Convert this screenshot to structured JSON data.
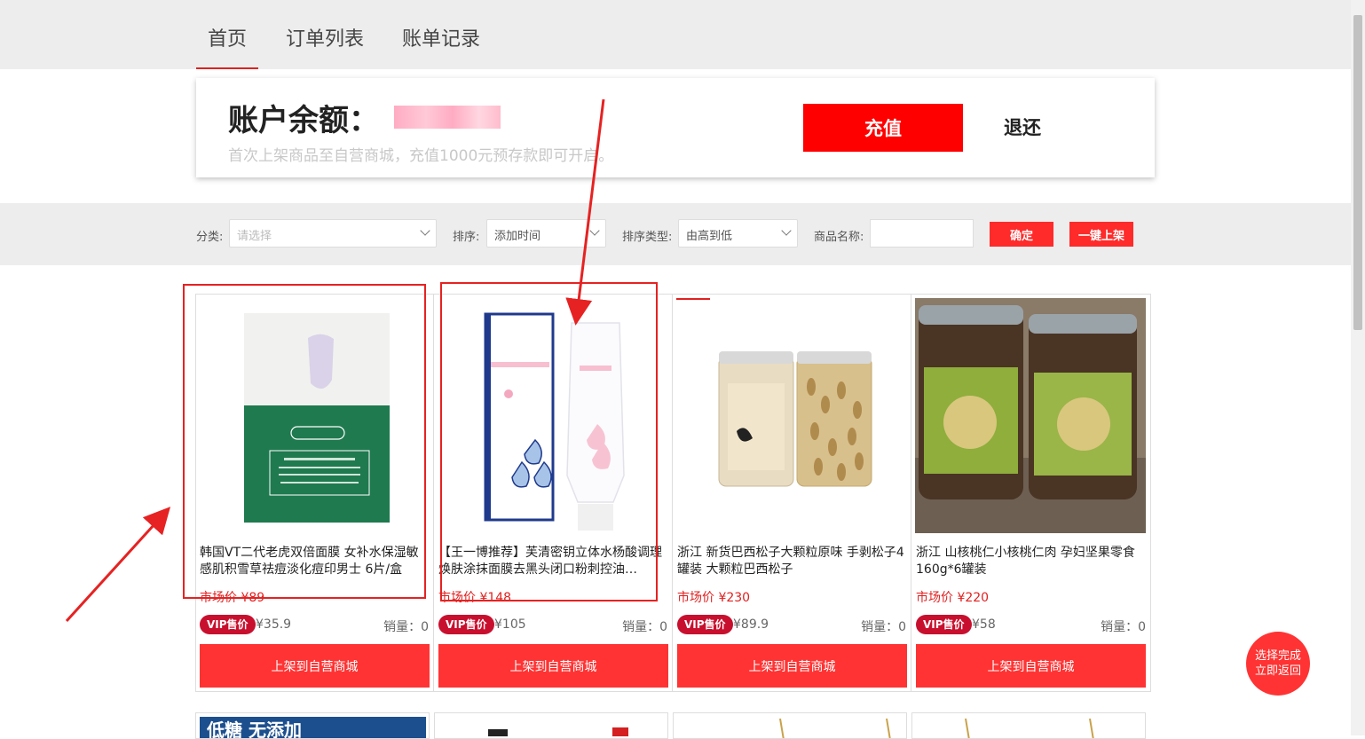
{
  "nav": {
    "tabs": [
      {
        "label": "首页"
      },
      {
        "label": "订单列表"
      },
      {
        "label": "账单记录"
      }
    ],
    "active_tab": "首页"
  },
  "balance": {
    "title": "账户余额：",
    "value_hidden": true,
    "subtitle": "首次上架商品至自营商城，充值1000元预存款即可开启。",
    "recharge_label": "充值",
    "refund_label": "退还"
  },
  "filters": {
    "category_label": "分类:",
    "category_placeholder": "请选择",
    "sort_label": "排序:",
    "sort_value": "添加时间",
    "sort_type_label": "排序类型:",
    "sort_type_value": "由高到低",
    "name_label": "商品名称:",
    "confirm_label": "确定",
    "bulk_list_label": "一键上架"
  },
  "products": [
    {
      "name": "韩国VT二代老虎双倍面膜 女补水保湿敏感肌积雪草祛痘淡化痘印男士 6片/盒",
      "market_price": "市场价 ¥89",
      "vip_badge": "VIP售价",
      "vip_price": "¥35.9",
      "sales": "销量：0",
      "action": "上架到自营商城",
      "image": "vt-cica-mask"
    },
    {
      "name": "【王一博推荐】芙清密钥立体水杨酸调理焕肤涂抹面膜去黑头闭口粉刺控油…",
      "market_price": "市场价 ¥148",
      "vip_badge": "VIP售价",
      "vip_price": "¥105",
      "sales": "销量：0",
      "action": "上架到自营商城",
      "image": "fuqing-mask-tube"
    },
    {
      "name": "浙江 新货巴西松子大颗粒原味 手剥松子4罐装 大颗粒巴西松子",
      "market_price": "市场价 ¥230",
      "vip_badge": "VIP售价",
      "vip_price": "¥89.9",
      "sales": "销量：0",
      "action": "上架到自营商城",
      "image": "pine-nut-jars"
    },
    {
      "name": "浙江 山核桃仁小核桃仁肉 孕妇坚果零食160g*6罐装",
      "market_price": "市场价 ¥220",
      "vip_badge": "VIP售价",
      "vip_price": "¥58",
      "sales": "销量：0",
      "action": "上架到自营商城",
      "image": "hickory-nut-jars"
    }
  ],
  "row2_partial_text": "低糖 无添加",
  "float_button": {
    "line1": "选择完成",
    "line2": "立即返回"
  },
  "colors": {
    "accent": "#ff3333",
    "vip": "#c8102e",
    "market_price": "#e02020",
    "annotation": "#e62222"
  }
}
